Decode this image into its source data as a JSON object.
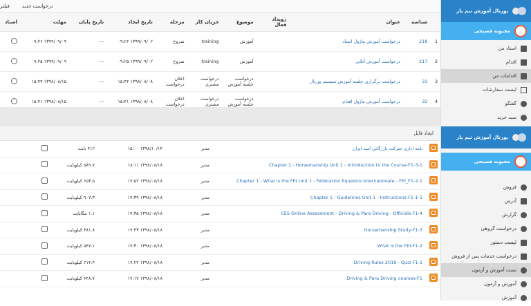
{
  "top_sidebar": {
    "app_title": "پورتال آموزش تیم یار",
    "user_name": "محبوبه فصیحی",
    "items": [
      {
        "label": "اسناد من",
        "icon": "document-icon"
      },
      {
        "label": "اقدام",
        "icon": "checklist-icon"
      },
      {
        "label": "اقدامات من",
        "icon": "list-icon"
      },
      {
        "label": "لیست سفارشات",
        "icon": "cart-icon"
      },
      {
        "label": "گفتگو",
        "icon": "chat-icon"
      },
      {
        "label": "سبد خرید",
        "icon": "basket-icon"
      }
    ]
  },
  "bottom_sidebar": {
    "app_title": "پورتال آموزش تیم یار",
    "user_name": "محبوبه فصیحی",
    "items": [
      {
        "label": "فروش",
        "icon": "sales-icon"
      },
      {
        "label": "آدرس",
        "icon": "address-icon"
      },
      {
        "label": "گزارش",
        "icon": "report-icon"
      },
      {
        "label": "درخواست گروهی",
        "icon": "group-request-icon"
      },
      {
        "label": "لیست دستور",
        "icon": "command-list-icon"
      },
      {
        "label": "درخواست خدمات پس از فروش",
        "icon": "service-icon"
      },
      {
        "label": "تست آموزش و آزمون",
        "icon": "test-icon"
      },
      {
        "label": "آموزش و آزمون",
        "icon": "exam-icon"
      },
      {
        "label": "آموزش",
        "icon": "training-icon"
      }
    ]
  },
  "toolbar": {
    "new_request": "درخواست جدید",
    "filter": "فیلتر"
  },
  "requests": {
    "headers": {
      "id": "شناسه",
      "title": "عنوان",
      "event": "رویداد فعال",
      "subject": "موضوع",
      "workflow": "جریان کار",
      "stage": "مرحله",
      "created": "تاریخ ایجاد",
      "end": "تاریخ پایان",
      "deadline": "مهلت",
      "docs": "اسناد"
    },
    "rows": [
      {
        "num": "1",
        "id": "218",
        "title": "درخواست آموزش ماژول اسناد",
        "event": "",
        "subject": "آموزش",
        "workflow": "training",
        "stage": "شروع",
        "created": "۱۳۹۹/۰۹/۰۲   ۰۹:۲۶",
        "end": "---",
        "deadline": "۱۳۹۹/۰۹/۰۹   ۰۹:۲۶"
      },
      {
        "num": "2",
        "id": "217",
        "title": "درخواست آموزش آنلاین",
        "event": "",
        "subject": "آموزش",
        "workflow": "training",
        "stage": "شروع",
        "created": "۱۳۹۹/۰۹/۰۲   ۰۹:۲۵",
        "end": "---",
        "deadline": "۱۳۹۹/۰۹/۰۹   ۰۹:۲۵"
      },
      {
        "num": "3",
        "id": "33",
        "title": "درخواست برگزاری جلسه آموزش سیستم پورتال",
        "event": "",
        "subject": "درخواست جلسه آموزش",
        "workflow": "درخواست مشتری",
        "stage": "اعلان درخواست",
        "created": "۱۳۹۸/۰۸/۰۸   ۱۵:۴۴",
        "end": "---",
        "deadline": "۱۳۹۸/۰۸/۱۵   ۱۵:۴۴"
      },
      {
        "num": "4",
        "id": "32",
        "title": "درخواست آموزش ماژول اقدام",
        "event": "",
        "subject": "درخواست جلسه آموزش",
        "workflow": "درخواست مشتری",
        "stage": "اعلان درخواست",
        "created": "۱۳۹۸/۰۸/۰۸   ۱۵:۴۱",
        "end": "---",
        "deadline": "۱۳۹۸/۰۸/۱۵   ۱۵:۴۱"
      }
    ]
  },
  "files": {
    "header": "ایجاد فایل",
    "rows": [
      {
        "name": "نامه اداری-شرکت بازرگانی امید ایران",
        "owner": "مدیر",
        "date": "۱۳۹۸/۱۰/۱۴  ۱۵:۰۰",
        "size": "۴۱۲ بایت"
      },
      {
        "name": "Chapter 1 - Horsemanship Unit 1 - Introduction to the Course-F1-3-1",
        "owner": "مدیر",
        "date": "۱۳۹۸/۰۸/۱۸  ۱۸:۱۱",
        "size": "۵۸۹.۷ کیلوبایت"
      },
      {
        "name": "Chapter 1 - What is the FEI Unit 1 - Fédération Equestre Internationale - FEI_F1-2-1",
        "owner": "مدیر",
        "date": "۱۳۹۸/۰۸/۱۸  ۱۷:۵۲",
        "size": "۶۵۳.۵ کیلوبایت"
      },
      {
        "name": "Chapter 1 - Guidelines Unit 1 - Instructions-F1-1-1",
        "owner": "مدیر",
        "date": "۱۳۹۸/۰۸/۱۸  ۱۷:۳۹",
        "size": "۹۰۷.۳ کیلوبایت"
      },
      {
        "name": "CES Online Assessment - Driving & Para Driving - Officials-F1-4",
        "owner": "مدیر",
        "date": "۱۳۹۸/۰۸/۱۸  ۱۷:۳۵",
        "size": "۱.۱ مگابایت"
      },
      {
        "name": "Horsemanship Study-F1-3",
        "owner": "مدیر",
        "date": "۱۳۹۸/۰۸/۱۸  ۱۷:۳۳",
        "size": "۳۸۱.۸ کیلوبایت"
      },
      {
        "name": "What is the FEI-F1-2",
        "owner": "مدیر",
        "date": "۱۳۹۸/۰۸/۱۸  ۱۷:۳۰",
        "size": "۵۴۷.۱ کیلوبایت"
      },
      {
        "name": "Driving Rules 2019 - Quiz-F1-1",
        "owner": "مدیر",
        "date": "۱۳۹۸/۰۸/۱۸  ۱۷:۲۴",
        "size": "۲۱۴.۴ کیلوبایت"
      },
      {
        "name": "Driving & Para Driving courses-F1",
        "owner": "مدیر",
        "date": "۱۳۹۸/۰۸/۱۸  ۱۷:۱۷",
        "size": "۶۴۸.۷ کیلوبایت"
      }
    ]
  },
  "colors": {
    "header_blue": "#2a82c9",
    "user_blue": "#45b0f0",
    "link": "#2a70b8",
    "file_orange": "#f08a24"
  }
}
